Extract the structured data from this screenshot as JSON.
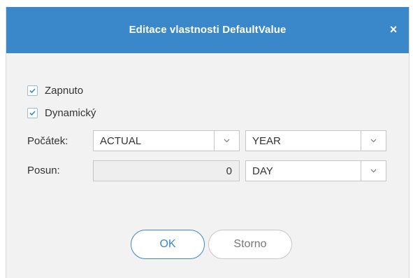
{
  "dialog": {
    "title": "Editace vlastnosti DefaultValue",
    "close_glyph": "×",
    "close_icon": "close-icon",
    "accent_color": "#3a88c9"
  },
  "checkboxes": [
    {
      "label": "Zapnuto",
      "checked": true
    },
    {
      "label": "Dynamický",
      "checked": true
    }
  ],
  "fields": {
    "pocatek": {
      "label": "Počátek:",
      "select1": {
        "value": "ACTUAL"
      },
      "select2": {
        "value": "YEAR"
      }
    },
    "posun": {
      "label": "Posun:",
      "number": {
        "value": "0"
      },
      "select": {
        "value": "DAY"
      }
    }
  },
  "buttons": {
    "ok": "OK",
    "cancel": "Storno"
  }
}
